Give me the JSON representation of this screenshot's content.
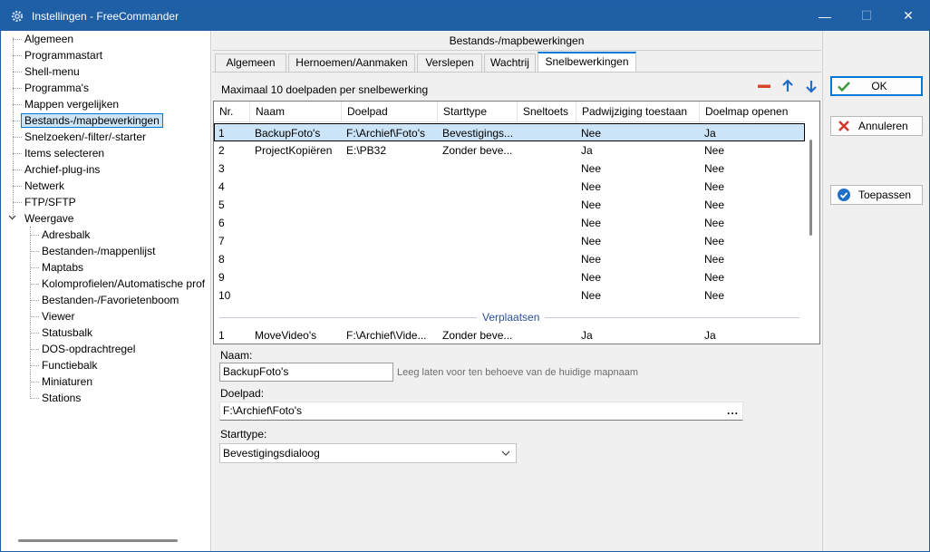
{
  "window": {
    "title": "Instellingen - FreeCommander",
    "controls": {
      "minimize": "—",
      "maximize": "☐",
      "close": "✕"
    }
  },
  "tree": {
    "items": [
      {
        "label": "Algemeen"
      },
      {
        "label": "Programmastart"
      },
      {
        "label": "Shell-menu"
      },
      {
        "label": "Programma's"
      },
      {
        "label": "Mappen vergelijken"
      },
      {
        "label": "Bestands-/mapbewerkingen"
      },
      {
        "label": "Snelzoeken/-filter/-starter"
      },
      {
        "label": "Items selecteren"
      },
      {
        "label": "Archief-plug-ins"
      },
      {
        "label": "Netwerk"
      },
      {
        "label": "FTP/SFTP"
      },
      {
        "label": "Weergave"
      }
    ],
    "children": [
      {
        "label": "Adresbalk"
      },
      {
        "label": "Bestanden-/mappenlijst"
      },
      {
        "label": "Maptabs"
      },
      {
        "label": "Kolomprofielen/Automatische prof"
      },
      {
        "label": "Bestanden-/Favorietenboom"
      },
      {
        "label": "Viewer"
      },
      {
        "label": "Statusbalk"
      },
      {
        "label": "DOS-opdrachtregel"
      },
      {
        "label": "Functiebalk"
      },
      {
        "label": "Miniaturen"
      },
      {
        "label": "Stations"
      }
    ]
  },
  "pane": {
    "header": "Bestands-/mapbewerkingen",
    "tabs": [
      "Algemeen",
      "Hernoemen/Aanmaken",
      "Verslepen",
      "Wachtrij",
      "Snelbewerkingen"
    ],
    "max_label": "Maximaal 10 doelpaden per snelbewerking",
    "columns": [
      "Nr.",
      "Naam",
      "Doelpad",
      "Starttype",
      "Sneltoets",
      "Padwijziging toestaan",
      "Doelmap openen"
    ],
    "rows": [
      {
        "nr": "1",
        "naam": "BackupFoto's",
        "doelpad": "F:\\Archief\\Foto's",
        "starttype": "Bevestigings...",
        "sneltoets": "",
        "padwijziging": "Nee",
        "doelmap": "Ja"
      },
      {
        "nr": "2",
        "naam": "ProjectKopiëren",
        "doelpad": "E:\\PB32",
        "starttype": "Zonder beve...",
        "sneltoets": "",
        "padwijziging": "Ja",
        "doelmap": "Nee"
      },
      {
        "nr": "3",
        "naam": "",
        "doelpad": "",
        "starttype": "",
        "sneltoets": "",
        "padwijziging": "Nee",
        "doelmap": "Nee"
      },
      {
        "nr": "4",
        "naam": "",
        "doelpad": "",
        "starttype": "",
        "sneltoets": "",
        "padwijziging": "Nee",
        "doelmap": "Nee"
      },
      {
        "nr": "5",
        "naam": "",
        "doelpad": "",
        "starttype": "",
        "sneltoets": "",
        "padwijziging": "Nee",
        "doelmap": "Nee"
      },
      {
        "nr": "6",
        "naam": "",
        "doelpad": "",
        "starttype": "",
        "sneltoets": "",
        "padwijziging": "Nee",
        "doelmap": "Nee"
      },
      {
        "nr": "7",
        "naam": "",
        "doelpad": "",
        "starttype": "",
        "sneltoets": "",
        "padwijziging": "Nee",
        "doelmap": "Nee"
      },
      {
        "nr": "8",
        "naam": "",
        "doelpad": "",
        "starttype": "",
        "sneltoets": "",
        "padwijziging": "Nee",
        "doelmap": "Nee"
      },
      {
        "nr": "9",
        "naam": "",
        "doelpad": "",
        "starttype": "",
        "sneltoets": "",
        "padwijziging": "Nee",
        "doelmap": "Nee"
      },
      {
        "nr": "10",
        "naam": "",
        "doelpad": "",
        "starttype": "",
        "sneltoets": "",
        "padwijziging": "Nee",
        "doelmap": "Nee"
      }
    ],
    "group_label": "Verplaatsen",
    "group_rows": [
      {
        "nr": "1",
        "naam": "MoveVideo's",
        "doelpad": "F:\\Archief\\Vide...",
        "starttype": "Zonder beve...",
        "sneltoets": "",
        "padwijziging": "Ja",
        "doelmap": "Ja"
      }
    ],
    "form": {
      "naam_label": "Naam:",
      "naam_value": "BackupFoto's",
      "naam_hint": "Leeg laten voor ten behoeve van de huidige mapnaam",
      "doelpad_label": "Doelpad:",
      "doelpad_value": "F:\\Archief\\Foto's",
      "browse": "...",
      "starttype_label": "Starttype:",
      "starttype_value": "Bevestigingsdialoog"
    }
  },
  "buttons": {
    "ok": "OK",
    "cancel": "Annuleren",
    "apply": "Toepassen"
  },
  "colors": {
    "titlebar": "#1f5fa6",
    "accent": "#0078d7",
    "selection": "#cce4f7",
    "remove": "#d9472b",
    "arrows": "#1f6fc6"
  }
}
